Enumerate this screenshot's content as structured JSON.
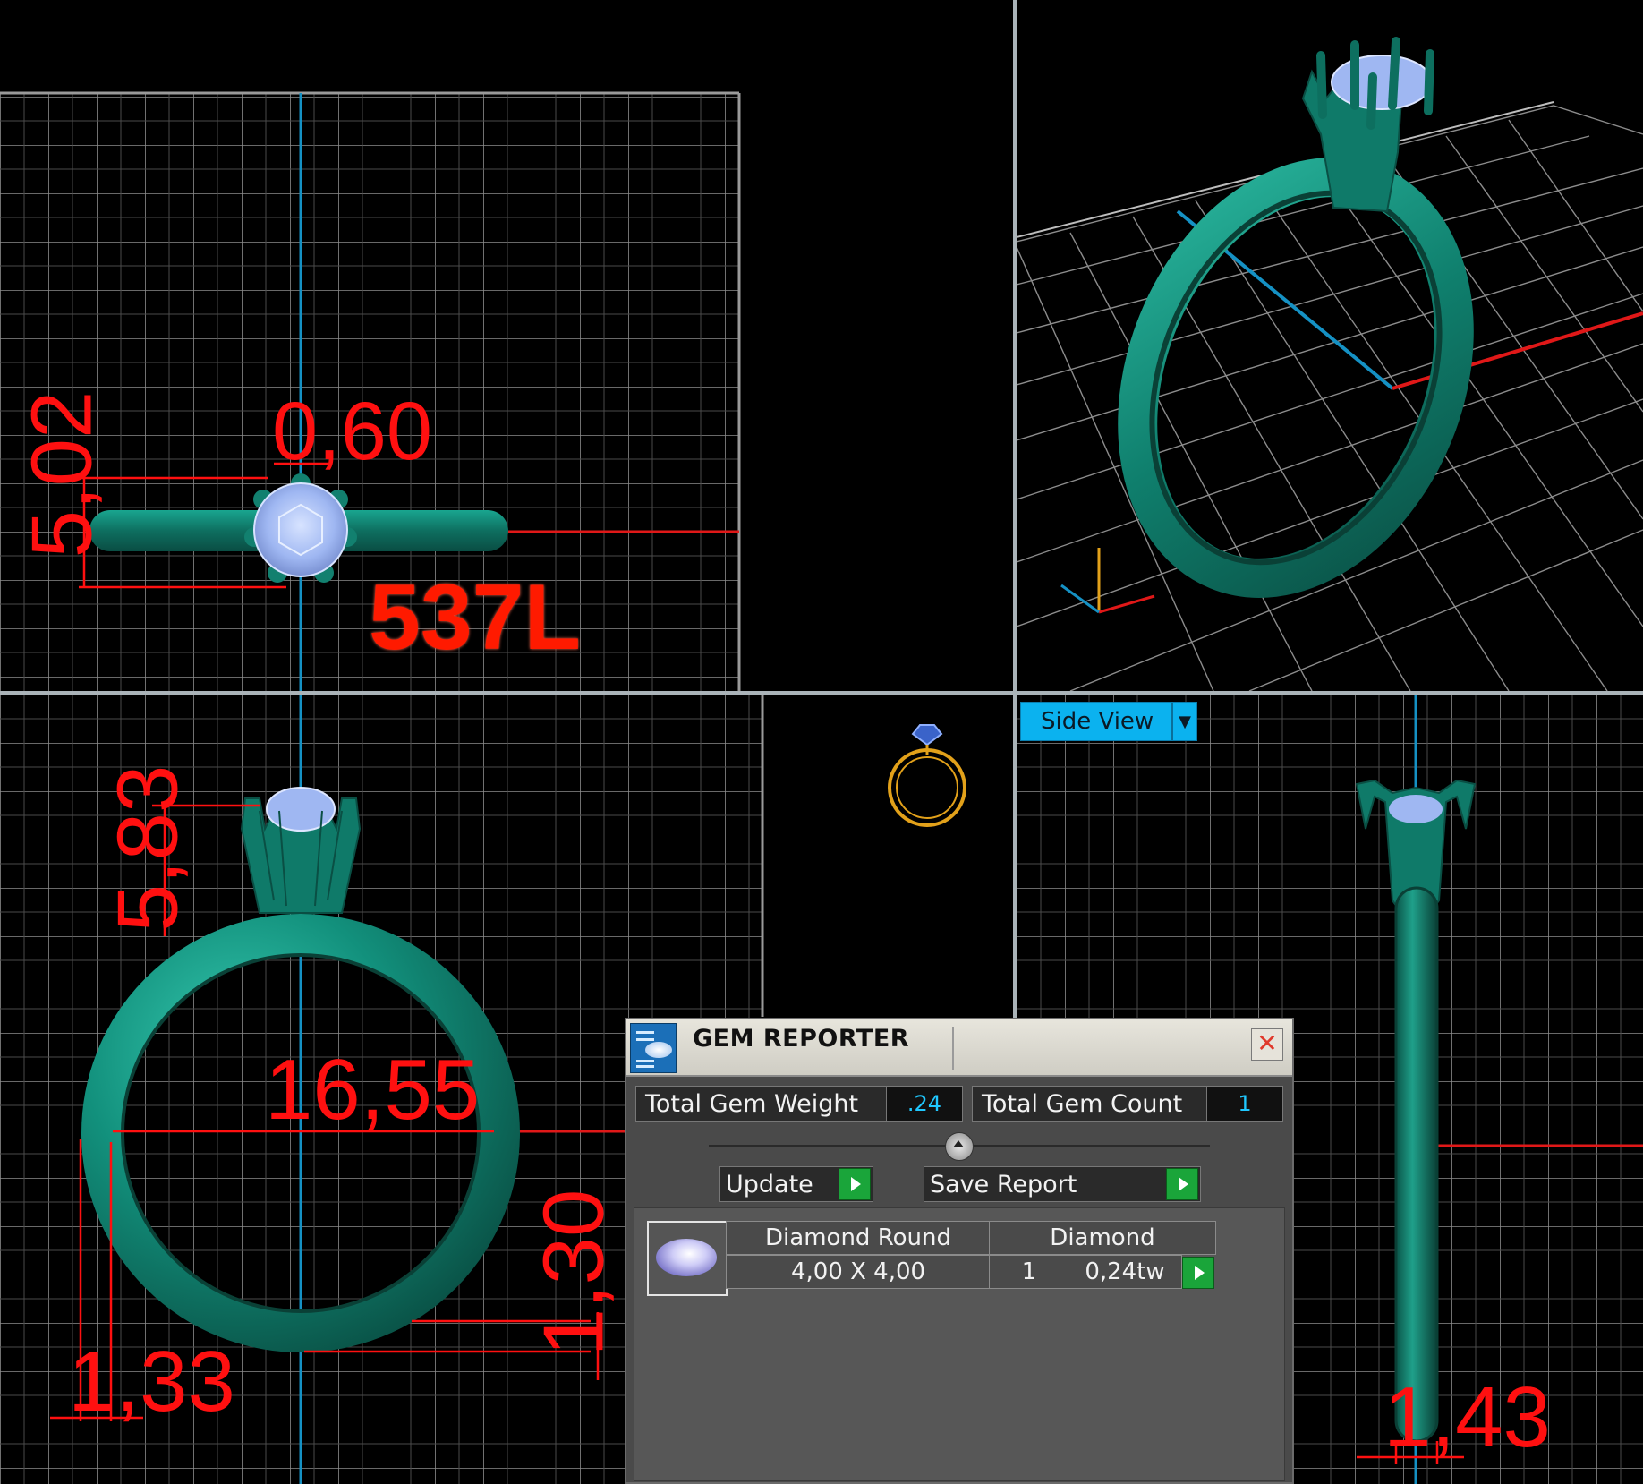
{
  "viewports": {
    "top_view": {
      "dimensions": [
        "5,02",
        "0,60"
      ],
      "model_label": "537L"
    },
    "perspective_view": {},
    "front_view": {
      "dimensions": [
        "5,83",
        "16,55",
        "1,30",
        "1,33"
      ]
    },
    "side_view": {
      "view_selector_label": "Side View",
      "dimensions": [
        "1,43"
      ]
    }
  },
  "gem_reporter": {
    "title": "GEM REPORTER",
    "total_weight_label": "Total Gem Weight",
    "total_weight_value": ".24",
    "total_count_label": "Total Gem Count",
    "total_count_value": "1",
    "update_label": "Update",
    "save_report_label": "Save Report",
    "gems": [
      {
        "shape": "Diamond Round",
        "material": "Diamond",
        "size": "4,00 X 4,00",
        "count": "1",
        "weight": "0,24tw"
      }
    ]
  },
  "colors": {
    "grid": "#8c8c8c",
    "ring": "#0e8c7a",
    "dimension": "#ff1010",
    "axis_blue": "#1591c4",
    "axis_red": "#e01818",
    "view_tab": "#0bb2ef",
    "gem": "#9fb7f2"
  },
  "icons": [
    "ring-thumbnail-icon",
    "gem-reporter-logo-icon",
    "close-icon",
    "dropdown-arrow-icon",
    "play-arrow-icon",
    "diamond-thumbnail-icon"
  ]
}
